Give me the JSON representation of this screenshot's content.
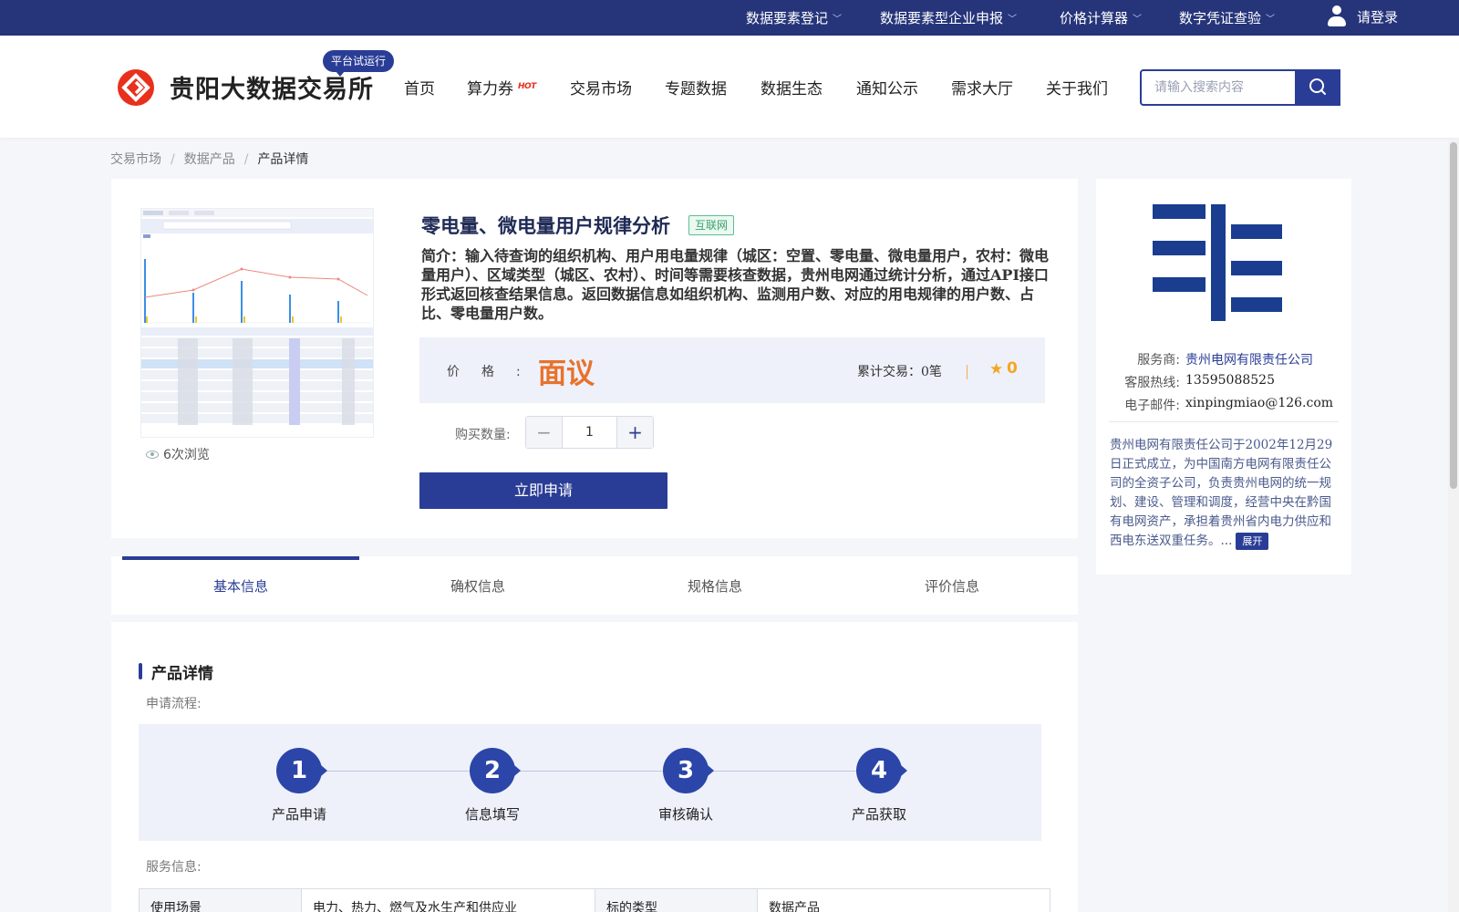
{
  "topbar": {
    "items": [
      {
        "label": "数据要素登记"
      },
      {
        "label": "数据要素型企业申报"
      },
      {
        "label": "价格计算器"
      },
      {
        "label": "数字凭证查验"
      }
    ],
    "login_label": "请登录"
  },
  "header": {
    "site_title": "贵阳大数据交易所",
    "trial_badge": "平台试运行",
    "nav": [
      {
        "label": "首页"
      },
      {
        "label": "算力券"
      },
      {
        "label": "交易市场"
      },
      {
        "label": "专题数据"
      },
      {
        "label": "数据生态"
      },
      {
        "label": "通知公示"
      },
      {
        "label": "需求大厅"
      },
      {
        "label": "关于我们"
      }
    ],
    "hot_tag": "HOT",
    "search_placeholder": "请输入搜索内容"
  },
  "breadcrumb": {
    "items": [
      "交易市场",
      "数据产品"
    ],
    "separator": "/",
    "current": "产品详情"
  },
  "product": {
    "title": "零电量、微电量用户规律分析",
    "tag": "互联网",
    "description": "简介：输入待查询的组织机构、用户用电量规律（城区：空置、零电量、微电量用户，农村：微电量用户）、区域类型（城区、农村）、时间等需要核查数据，贵州电网通过统计分析，通过API接口形式返回核查结果信息。返回数据信息如组织机构、监测用户数、对应的用电规律的用户数、占比、零电量用户数。",
    "views": "6次浏览",
    "price_label": "价格:",
    "price_value": "面议",
    "trade_label": "累计交易：",
    "trade_value": "0笔",
    "rating": "0",
    "qty_label": "购买数量:",
    "qty_value": "1",
    "apply_label": "立即申请"
  },
  "supplier": {
    "provider_label": "服务商:",
    "provider_value": "贵州电网有限责任公司",
    "hotline_label": "客服热线:",
    "hotline_value": "13595088525",
    "email_label": "电子邮件:",
    "email_value": "xinpingmiao@126.com",
    "description": "贵州电网有限责任公司于2002年12月29日正式成立，为中国南方电网有限责任公司的全资子公司，负责贵州电网的统一规划、建设、管理和调度，经营中央在黔国有电网资产，承担着贵州省内电力供应和西电东送双重任务。...",
    "expand_label": "展开"
  },
  "tabs": [
    {
      "label": "基本信息"
    },
    {
      "label": "确权信息"
    },
    {
      "label": "规格信息"
    },
    {
      "label": "评价信息"
    }
  ],
  "detail": {
    "section_title": "产品详情",
    "process_label": "申请流程:",
    "steps": [
      {
        "num": "1",
        "label": "产品申请"
      },
      {
        "num": "2",
        "label": "信息填写"
      },
      {
        "num": "3",
        "label": "审核确认"
      },
      {
        "num": "4",
        "label": "产品获取"
      }
    ],
    "service_label": "服务信息:",
    "service_table": {
      "k1": "使用场景",
      "v1": "电力、热力、燃气及水生产和供应业",
      "k2": "标的类型",
      "v2": "数据产品"
    }
  },
  "colors": {
    "brand_navy": "#26357a",
    "accent_blue": "#2a3d96",
    "price_orange": "#e8722c",
    "rating_gold": "#f4a623",
    "logo_red": "#e8301c"
  }
}
